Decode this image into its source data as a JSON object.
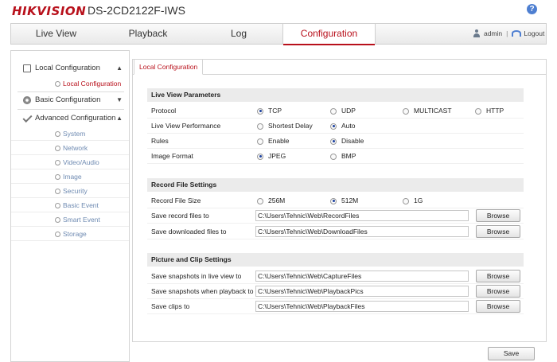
{
  "brand": {
    "logo": "HIKVISION",
    "model": "DS-2CD2122F-IWS"
  },
  "nav": {
    "tabs": [
      {
        "label": "Live View"
      },
      {
        "label": "Playback"
      },
      {
        "label": "Log"
      },
      {
        "label": "Configuration",
        "active": true
      }
    ],
    "user": "admin",
    "separator": "|",
    "logout": "Logout"
  },
  "sidebar": {
    "local": "Local Configuration",
    "local_sub": "Local Configuration",
    "basic": "Basic Configuration",
    "advanced": "Advanced Configuration",
    "advanced_items": [
      "System",
      "Network",
      "Video/Audio",
      "Image",
      "Security",
      "Basic Event",
      "Smart Event",
      "Storage"
    ]
  },
  "content": {
    "tab": "Local Configuration",
    "live": {
      "title": "Live View Parameters",
      "protocol": {
        "label": "Protocol",
        "options": [
          "TCP",
          "UDP",
          "MULTICAST",
          "HTTP"
        ],
        "selected": "TCP"
      },
      "performance": {
        "label": "Live View Performance",
        "options": [
          "Shortest Delay",
          "Auto"
        ],
        "selected": "Auto"
      },
      "rules": {
        "label": "Rules",
        "options": [
          "Enable",
          "Disable"
        ],
        "selected": "Disable"
      },
      "format": {
        "label": "Image Format",
        "options": [
          "JPEG",
          "BMP"
        ],
        "selected": "JPEG"
      }
    },
    "record": {
      "title": "Record File Settings",
      "size": {
        "label": "Record File Size",
        "options": [
          "256M",
          "512M",
          "1G"
        ],
        "selected": "512M"
      },
      "save_record": {
        "label": "Save record files to",
        "value": "C:\\Users\\Tehnic\\Web\\RecordFiles"
      },
      "save_download": {
        "label": "Save downloaded files to",
        "value": "C:\\Users\\Tehnic\\Web\\DownloadFiles"
      }
    },
    "picture": {
      "title": "Picture and Clip Settings",
      "snap_live": {
        "label": "Save snapshots in live view to",
        "value": "C:\\Users\\Tehnic\\Web\\CaptureFiles"
      },
      "snap_playback": {
        "label": "Save snapshots when playback to",
        "value": "C:\\Users\\Tehnic\\Web\\PlaybackPics"
      },
      "clips": {
        "label": "Save clips to",
        "value": "C:\\Users\\Tehnic\\Web\\PlaybackFiles"
      }
    },
    "browse_label": "Browse",
    "save_label": "Save"
  }
}
